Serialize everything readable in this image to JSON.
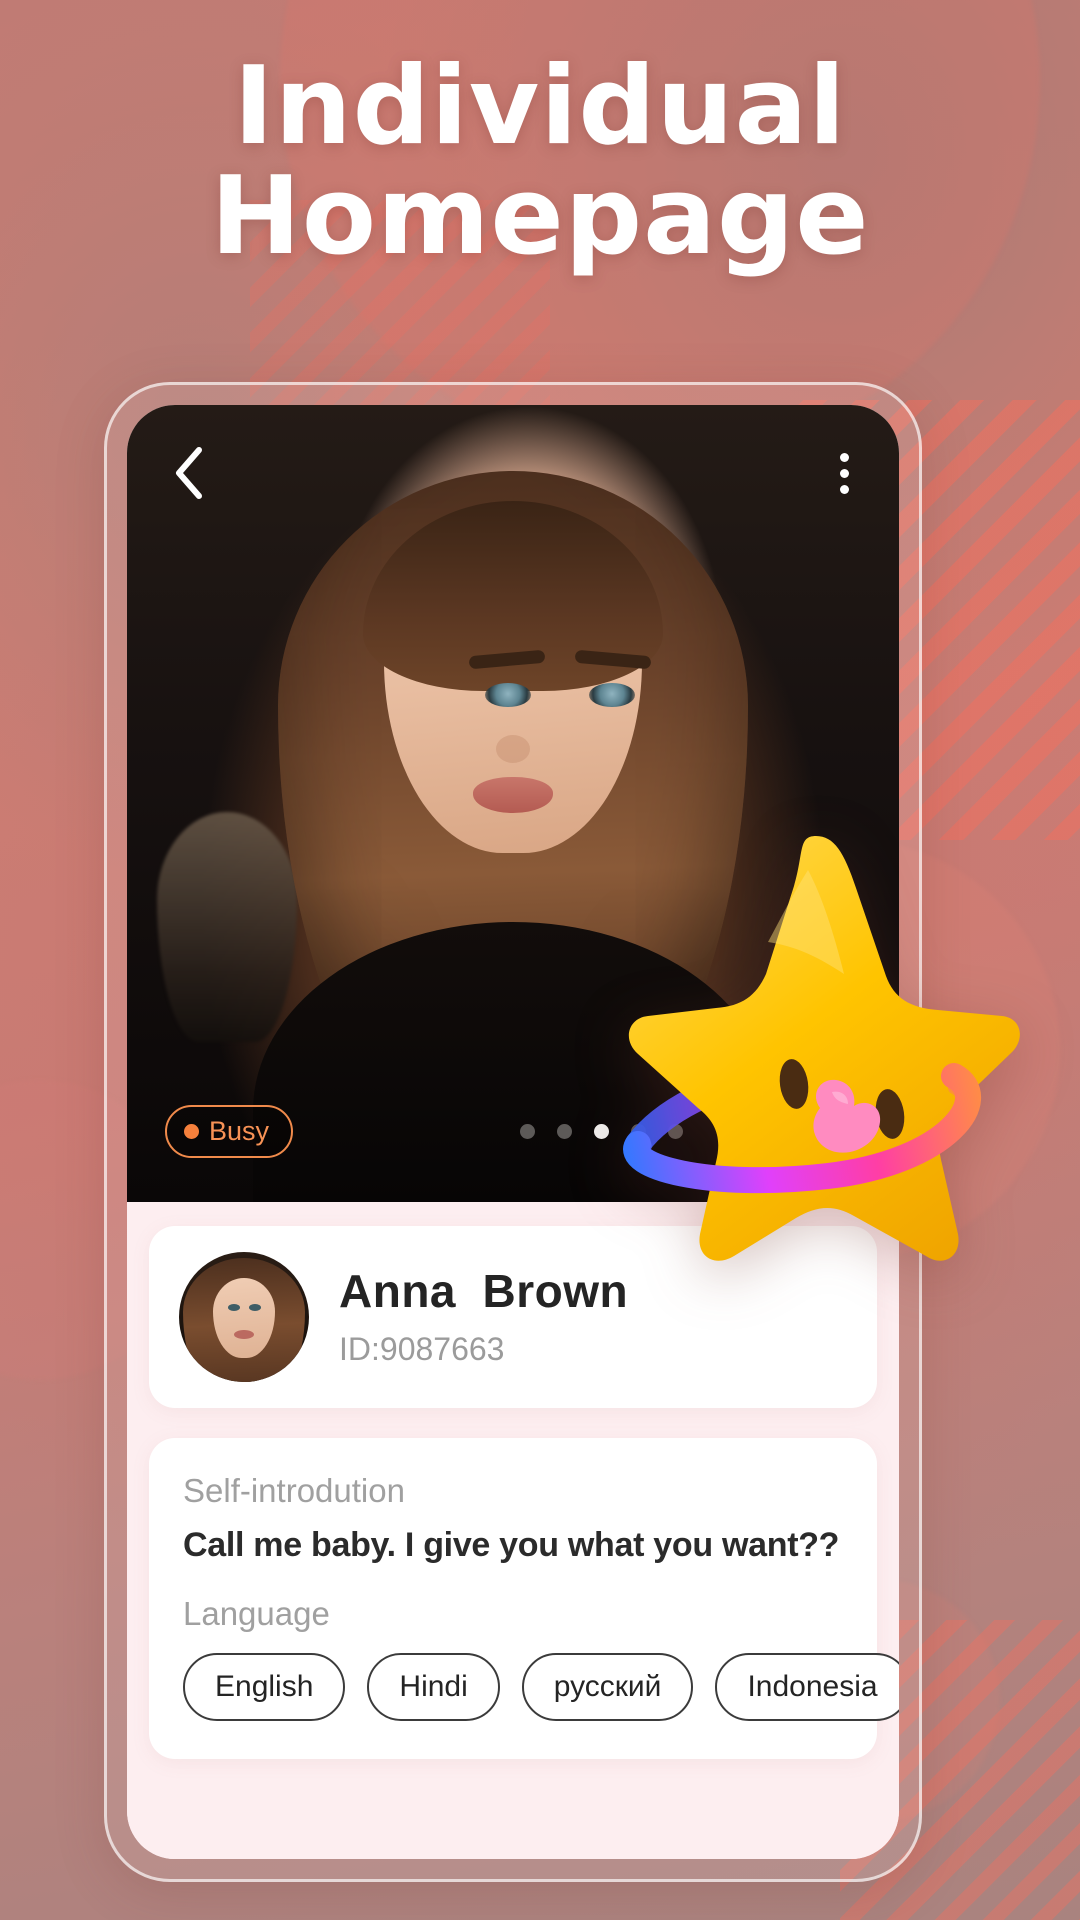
{
  "headline": {
    "line1": "Individual",
    "line2": "Homepage"
  },
  "phone": {
    "topnav": {
      "back_icon": "chevron-left-icon",
      "menu_icon": "kebab-menu-icon"
    },
    "hero": {
      "status_badge": {
        "label": "Busy",
        "dot_color": "#f5803c",
        "border_color": "#f08a4b",
        "text_color": "#f79255"
      },
      "pagination": {
        "count": 5,
        "active_index": 2
      }
    },
    "profile": {
      "name": "Anna  Brown",
      "id": "ID:9087663",
      "avatar_icon": "user-avatar"
    },
    "intro": {
      "self_intro_label": "Self-introdution",
      "self_intro_text": "Call me baby. I give you what you want??",
      "language_label": "Language",
      "languages": [
        "English",
        "Hindi",
        "русский",
        "Indonesia"
      ]
    }
  },
  "mascot": {
    "name": "star-mascot",
    "body_color": "#FFC400",
    "tongue_color": "#FF8BC0",
    "ring_colors": [
      "#2B7BFF",
      "#E040FB",
      "#FF3EA5",
      "#FFA726"
    ]
  },
  "theme": {
    "background": "#c9736c",
    "card": "#ffffff",
    "panel": "#fdeef0",
    "accent": "#f5803c"
  }
}
